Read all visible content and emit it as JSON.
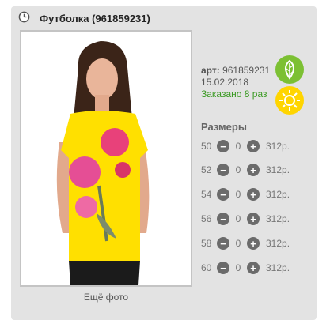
{
  "product": {
    "title": "Футболка (961859231)",
    "article_label": "арт:",
    "article": "961859231",
    "date": "15.02.2018",
    "ordered": "Заказано 8 раз",
    "more_photos": "Ещё фото"
  },
  "icons": {
    "clock": "clock-icon",
    "leaf": "leaf-icon",
    "sun": "sun-icon",
    "minus": "minus-icon",
    "plus": "plus-icon"
  },
  "colors": {
    "badge_leaf": "#7cc033",
    "badge_sun": "#ffd500",
    "ordered_text": "#3a9a23",
    "button": "#6b6b6b"
  },
  "sizes_title": "Размеры",
  "sizes": [
    {
      "size": "50",
      "qty": "0",
      "price": "312р."
    },
    {
      "size": "52",
      "qty": "0",
      "price": "312р."
    },
    {
      "size": "54",
      "qty": "0",
      "price": "312р."
    },
    {
      "size": "56",
      "qty": "0",
      "price": "312р."
    },
    {
      "size": "58",
      "qty": "0",
      "price": "312р."
    },
    {
      "size": "60",
      "qty": "0",
      "price": "312р."
    }
  ]
}
